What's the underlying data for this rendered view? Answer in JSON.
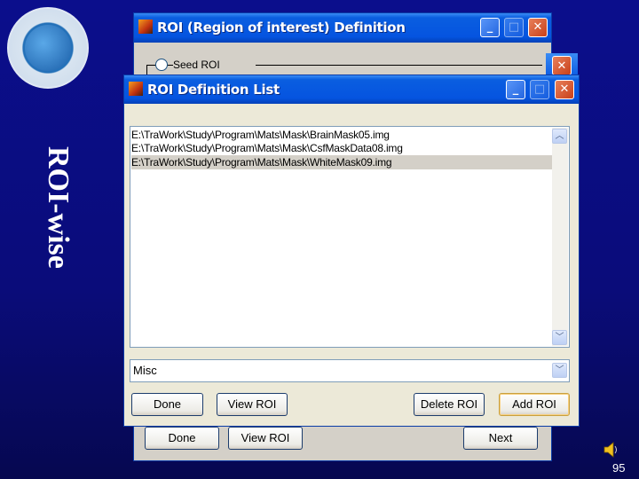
{
  "slide": {
    "title": "ROI-wise",
    "page_number": "95",
    "speaker_icon": "speaker-icon",
    "logo_icon": "lab-logo"
  },
  "back_window": {
    "title": "ROI (Region of interest) Definition",
    "radio_label": "Seed ROI",
    "buttons": {
      "done": "Done",
      "view_roi": "View ROI",
      "next": "Next"
    }
  },
  "front_window": {
    "title": "ROI Definition List",
    "list_items": [
      "E:\\TraWork\\Study\\Program\\Mats\\Mask\\BrainMask05.img",
      "E:\\TraWork\\Study\\Program\\Mats\\Mask\\CsfMaskData08.img",
      "E:\\TraWork\\Study\\Program\\Mats\\Mask\\WhiteMask09.img"
    ],
    "selected_index": 2,
    "popup_value": "Misc",
    "buttons": {
      "done": "Done",
      "view_roi": "View ROI",
      "delete_roi": "Delete ROI",
      "add_roi": "Add ROI"
    }
  },
  "window_controls": {
    "minimize": "_",
    "maximize": "□",
    "close": "✕"
  }
}
